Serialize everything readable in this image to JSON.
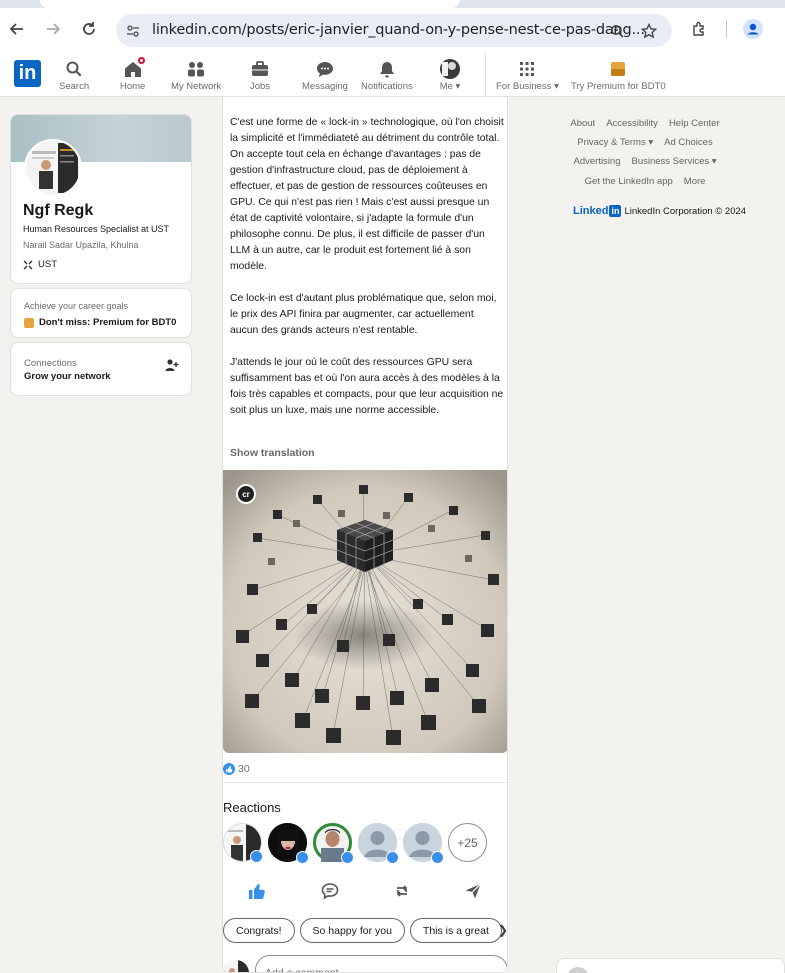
{
  "browser": {
    "url": "linkedin.com/posts/eric-janvier_quand-on-y-pense-nest-ce-pas-dang...",
    "accent": "#0b57d0"
  },
  "nav": {
    "logo": "in",
    "items": [
      {
        "label": "Search",
        "icon": "search-icon"
      },
      {
        "label": "Home",
        "icon": "home-icon"
      },
      {
        "label": "My Network",
        "icon": "network-icon"
      },
      {
        "label": "Jobs",
        "icon": "briefcase-icon"
      },
      {
        "label": "Messaging",
        "icon": "messaging-icon"
      },
      {
        "label": "Notifications",
        "icon": "bell-icon"
      },
      {
        "label": "Me",
        "icon": "avatar"
      },
      {
        "label": "For Business",
        "icon": "grid-icon"
      },
      {
        "label": "Try Premium for BDT0",
        "icon": "premium-icon"
      }
    ],
    "brand_color": "#0a66c2"
  },
  "profile": {
    "name": "Ngf Regk",
    "headline": "Human Resources Specialist at UST",
    "location": "Narail Sadar Upazila, Khulna",
    "company": "UST"
  },
  "goals": {
    "title": "Achieve your career goals",
    "cta": "Don't miss: Premium for BDT0"
  },
  "connections": {
    "title": "Connections",
    "subtitle": "Grow your network"
  },
  "post": {
    "paragraphs": [
      "C'est une forme de « lock-in » technologique, où l'on choisit la simplicité et l'immédiateté au détriment du contrôle total. On accepte tout cela en échange d'avantages : pas de gestion d'infrastructure cloud, pas de déploiement à effectuer, et pas de gestion de ressources coûteuses en GPU. Ce qui n'est pas rien ! Mais c'est aussi presque un état de captivité volontaire, si j'adapte la formule d'un philosophe connu. De plus, il est difficile de passer d'un LLM à un autre, car le produit est fortement lié à son modèle.",
      "Ce lock-in est d'autant plus problématique que, selon moi, le prix des API finira par augmenter, car actuellement aucun des grands acteurs n'est rentable.",
      "J'attends le jour où le coût des ressources GPU sera suffisamment bas et où l'on aura accès à des modèles à la fois très capables et compacts, pour que leur acquisition ne soit plus un luxe, mais une norme accessible."
    ],
    "show_translation": "Show translation",
    "image_badge": "cr",
    "reaction_count": "30",
    "reactions_title": "Reactions",
    "more_reactors": "+25",
    "quick_replies": [
      "Congrats!",
      "So happy for you",
      "This is a great"
    ],
    "comment_placeholder": "Add a comment..."
  },
  "footer": {
    "rows": [
      [
        "About",
        "Accessibility",
        "Help Center"
      ],
      [
        "Privacy & Terms ▾",
        "Ad Choices"
      ],
      [
        "Advertising",
        "Business Services ▾"
      ],
      [
        "Get the LinkedIn app",
        "More"
      ]
    ],
    "brand_linked": "Linked",
    "brand_in": "in",
    "copyright": "LinkedIn Corporation © 2024"
  }
}
